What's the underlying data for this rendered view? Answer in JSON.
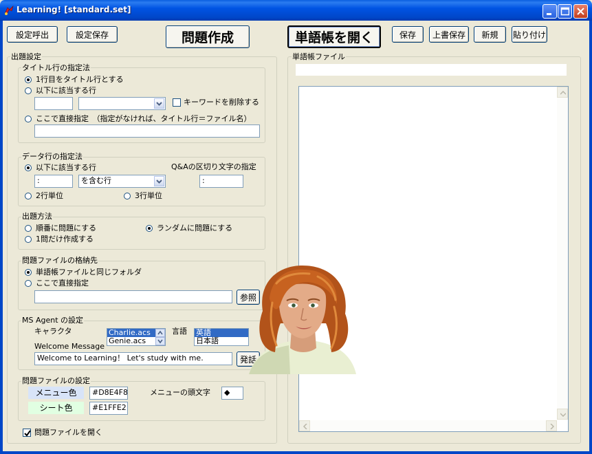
{
  "window": {
    "title": "Learning! [standard.set]"
  },
  "toolbar": {
    "load_settings": "設定呼出",
    "save_settings": "設定保存",
    "create_questions": "問題作成",
    "open_wordbook": "単語帳を開く",
    "save": "保存",
    "overwrite_save": "上書保存",
    "new": "新規",
    "paste": "貼り付け"
  },
  "settings": {
    "title": "出題設定",
    "title_row": {
      "title": "タイトル行の指定法",
      "option_first_row": "1行目をタイトル行とする",
      "option_matching_row": "以下に該当する行",
      "matching_value": "",
      "matching_combo_value": "",
      "delete_keyword": "キーワードを削除する",
      "option_direct": "ここで直接指定　（指定がなければ、タイトル行＝ファイル名）",
      "direct_value": ""
    },
    "data_row": {
      "title": "データ行の指定法",
      "option_matching_row": "以下に該当する行",
      "delimiter_label": "Q&Aの区切り文字の指定",
      "match_value": ":",
      "match_combo_value": "を含む行",
      "delimiter_value": ":",
      "option_two_lines": "2行単位",
      "option_three_lines": "3行単位"
    },
    "method": {
      "title": "出題方法",
      "option_sequential": "順番に問題にする",
      "option_random": "ランダムに問題にする",
      "option_single": "1問だけ作成する"
    },
    "destination": {
      "title": "問題ファイルの格納先",
      "option_same_folder": "単語帳ファイルと同じフォルダ",
      "option_direct": "ここで直接指定",
      "direct_value": "",
      "browse": "参照"
    },
    "agent": {
      "title": "MS Agent の設定",
      "character_label": "キャラクタ",
      "characters": [
        "Charlie.acs",
        "Genie.acs"
      ],
      "language_label": "言語",
      "languages": [
        "英語",
        "日本語"
      ],
      "welcome_label": "Welcome Message",
      "welcome_value": "Welcome to Learning！ Let's study with me.",
      "speak_button": "発話"
    },
    "file_settings": {
      "title": "問題ファイルの設定",
      "menu_color_label": "メニュー色",
      "menu_color_value": "#D8E4F8",
      "sheet_color_label": "シート色",
      "sheet_color_value": "#E1FFE2",
      "menu_prefix_label": "メニューの頭文字",
      "menu_prefix_value": "◆"
    },
    "open_question_file": "問題ファイルを開く"
  },
  "wordbook": {
    "title": "単語帳ファイル",
    "path": "",
    "content": ""
  },
  "colors": {
    "titlebar": "#0054e3",
    "menu_color_swatch": "#D8E4F8",
    "sheet_color_swatch": "#E1FFE2",
    "selection": "#316ac5"
  }
}
